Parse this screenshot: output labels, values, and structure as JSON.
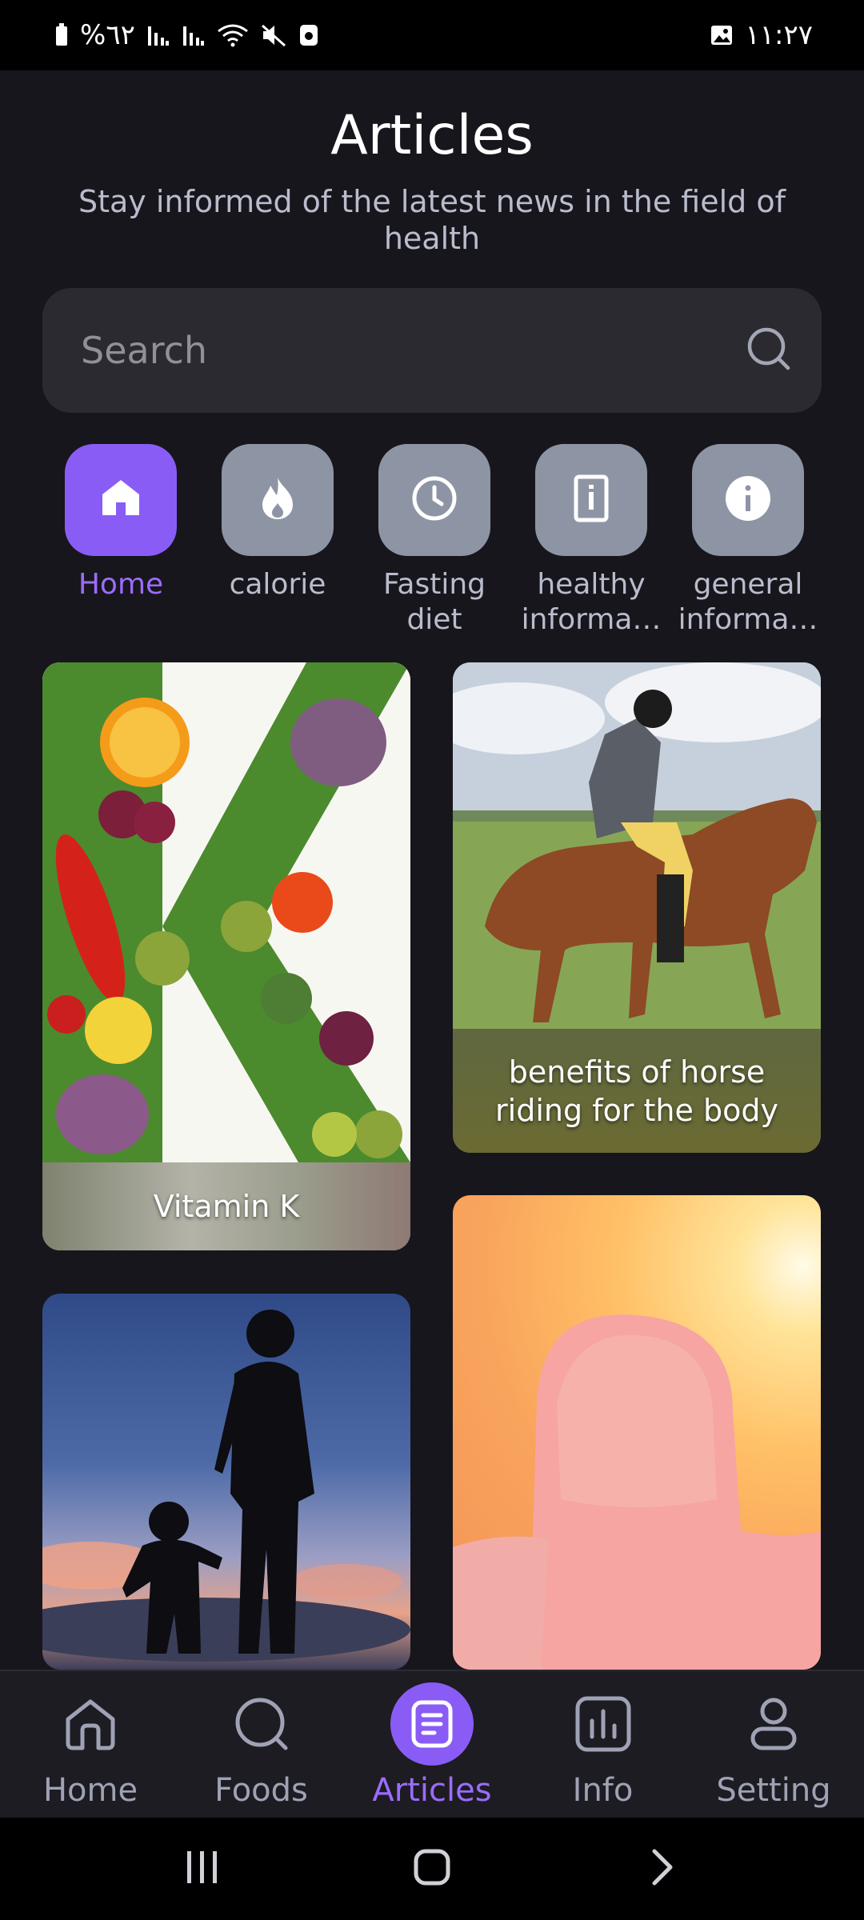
{
  "status_bar": {
    "battery": "%٦٢",
    "time": "١١:٢٧"
  },
  "header": {
    "title": "Articles",
    "subtitle": "Stay informed of the latest news in the field of health"
  },
  "search": {
    "placeholder": "Search"
  },
  "categories": [
    {
      "icon": "home-icon",
      "line1": "Home",
      "line2": ""
    },
    {
      "icon": "flame-icon",
      "line1": "calorie",
      "line2": ""
    },
    {
      "icon": "clock-icon",
      "line1": "Fasting",
      "line2": "diet"
    },
    {
      "icon": "phone-info-icon",
      "line1": "healthy",
      "line2": "informa…"
    },
    {
      "icon": "info-icon",
      "line1": "general",
      "line2": "informa…"
    }
  ],
  "articles": [
    {
      "caption": "Vitamin K"
    },
    {
      "caption": "benefits of horse riding for the body"
    },
    {
      "caption": ""
    },
    {
      "caption": ""
    }
  ],
  "bottom_nav": [
    {
      "label": "Home",
      "icon": "home-icon"
    },
    {
      "label": "Foods",
      "icon": "search-icon"
    },
    {
      "label": "Articles",
      "icon": "article-icon"
    },
    {
      "label": "Info",
      "icon": "chart-icon"
    },
    {
      "label": "Setting",
      "icon": "user-icon"
    }
  ],
  "colors": {
    "accent": "#8a5cf6",
    "background": "#17161c",
    "tile": "#8d95a5"
  }
}
